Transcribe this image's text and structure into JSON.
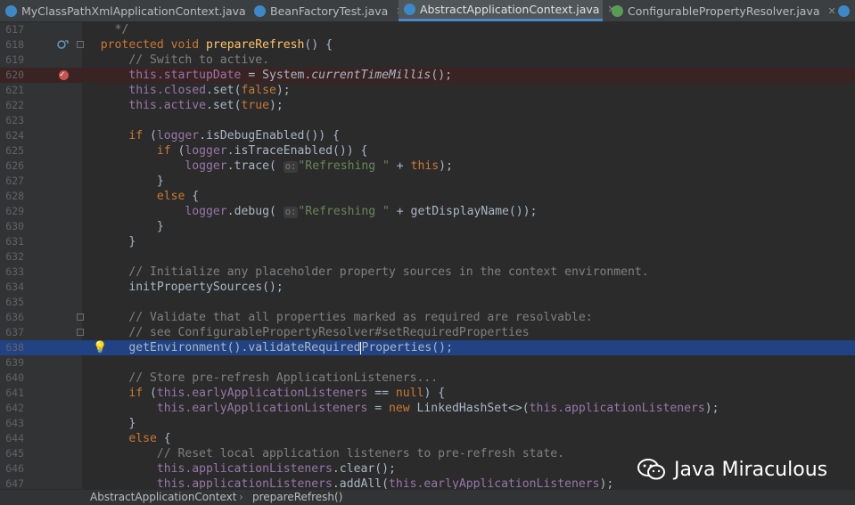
{
  "tabs": [
    {
      "label": "MyClassPathXmlApplicationContext.java",
      "icon": "class-icon",
      "active": false
    },
    {
      "label": "BeanFactoryTest.java",
      "icon": "class-icon",
      "active": false
    },
    {
      "label": "AbstractApplicationContext.java",
      "icon": "class-icon",
      "active": true
    },
    {
      "label": "ConfigurablePropertyResolver.java",
      "icon": "interface-icon",
      "active": false
    }
  ],
  "editor": {
    "lines": [
      {
        "num": "617"
      },
      {
        "num": "618"
      },
      {
        "num": "619"
      },
      {
        "num": "620"
      },
      {
        "num": "621"
      },
      {
        "num": "622"
      },
      {
        "num": "623"
      },
      {
        "num": "624"
      },
      {
        "num": "625"
      },
      {
        "num": "626"
      },
      {
        "num": "627"
      },
      {
        "num": "628"
      },
      {
        "num": "629"
      },
      {
        "num": "630"
      },
      {
        "num": "631"
      },
      {
        "num": "632"
      },
      {
        "num": "633"
      },
      {
        "num": "634"
      },
      {
        "num": "635"
      },
      {
        "num": "636"
      },
      {
        "num": "637"
      },
      {
        "num": "638"
      },
      {
        "num": "639"
      },
      {
        "num": "640"
      },
      {
        "num": "641"
      },
      {
        "num": "642"
      },
      {
        "num": "643"
      },
      {
        "num": "644"
      },
      {
        "num": "645"
      },
      {
        "num": "646"
      },
      {
        "num": "647"
      }
    ],
    "t": {
      "l617_c": "*/",
      "l618_kw": "protected void",
      "l618_m": "prepareRefresh",
      "l618_r": "() {",
      "l619_c": "// Switch to active.",
      "l620_f": "this.startupDate",
      "l620_a": " = System.",
      "l620_m": "currentTimeMillis",
      "l620_r": "();",
      "l621_f": "this.closed",
      "l621_a": ".set(",
      "l621_k": "false",
      "l621_r": ");",
      "l622_f": "this.active",
      "l622_a": ".set(",
      "l622_k": "true",
      "l622_r": ");",
      "l624_k": "if",
      "l624_a": " (",
      "l624_f": "logger",
      "l624_r": ".isDebugEnabled()) {",
      "l625_k": "if",
      "l625_a": " (",
      "l625_f": "logger",
      "l625_r": ".isTraceEnabled()) {",
      "l626_f": "logger",
      "l626_a": ".trace( ",
      "l626_h": "o:",
      "l626_s": "\"Refreshing \"",
      "l626_b": " + ",
      "l626_k": "this",
      "l626_r": ");",
      "l627_r": "}",
      "l628_k": "else",
      "l628_r": " {",
      "l629_f": "logger",
      "l629_a": ".debug( ",
      "l629_h": "o:",
      "l629_s": "\"Refreshing \"",
      "l629_r": " + getDisplayName());",
      "l630_r": "}",
      "l631_r": "}",
      "l633_c": "// Initialize any placeholder property sources in the context environment.",
      "l634_r": "initPropertySources();",
      "l636_c": "// Validate that all properties marked as required are resolvable:",
      "l637_c": "// see ConfigurablePropertyResolver#setRequiredProperties",
      "l638_a": "getEnvironment().validateRequired",
      "l638_b": "Properties();",
      "l640_c": "// Store pre-refresh ApplicationListeners...",
      "l641_k": "if",
      "l641_a": " (",
      "l641_f": "this.earlyApplicationListeners",
      "l641_b": " == ",
      "l641_k2": "null",
      "l641_r": ") {",
      "l642_f": "this.earlyApplicationListeners",
      "l642_a": " = ",
      "l642_k": "new",
      "l642_b": " LinkedHashSet<>(",
      "l642_f2": "this.applicationListeners",
      "l642_r": ");",
      "l643_r": "}",
      "l644_k": "else",
      "l644_r": " {",
      "l645_c": "// Reset local application listeners to pre-refresh state.",
      "l646_f": "this.applicationListeners",
      "l646_r": ".clear();",
      "l647_f": "this.applicationListeners",
      "l647_a": ".addAll(",
      "l647_f2": "this.earlyApplicationListeners",
      "l647_r": ");"
    }
  },
  "breadcrumb": {
    "items": [
      "AbstractApplicationContext",
      "prepareRefresh()"
    ],
    "separator": "›"
  },
  "watermark": {
    "text": "Java Miraculous",
    "icon": "wechat-icon"
  },
  "colors": {
    "background": "#2b2b2b",
    "gutter": "#313335",
    "keyword": "#cc7832",
    "field": "#9876aa",
    "string": "#6a8759",
    "comment": "#808080",
    "method": "#ffc66d",
    "selection": "#214283",
    "breakpoint": "#c75450",
    "tab_underline": "#4a88c7"
  }
}
